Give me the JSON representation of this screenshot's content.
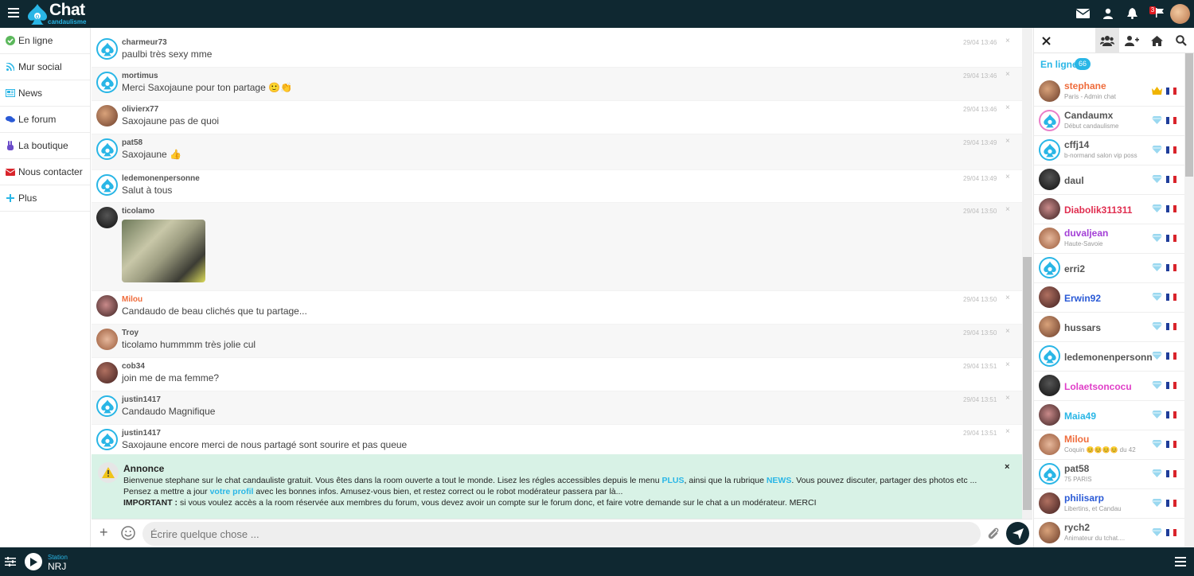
{
  "app": {
    "logo_main": "Chat",
    "logo_sub": "candaulisme",
    "notification_count": "3"
  },
  "colors": {
    "bar": "#0f2831",
    "accent": "#29b6e6",
    "annonce_bg": "#d8f2e6"
  },
  "nav": [
    {
      "label": "En ligne",
      "icon": "check-circle-icon",
      "color": "#5cb85c"
    },
    {
      "label": "Mur social",
      "icon": "rss-icon",
      "color": "#29b6e6"
    },
    {
      "label": "News",
      "icon": "newspaper-icon",
      "color": "#29b6e6"
    },
    {
      "label": "Le forum",
      "icon": "comments-icon",
      "color": "#2a5ad6"
    },
    {
      "label": "La boutique",
      "icon": "peace-hand-icon",
      "color": "#6b4cc9"
    },
    {
      "label": "Nous contacter",
      "icon": "envelope-icon",
      "color": "#d9242b"
    },
    {
      "label": "Plus",
      "icon": "plus-icon",
      "color": "#29b6e6"
    }
  ],
  "messages": [
    {
      "user": "charmeur73",
      "text": "paulbi très sexy mme",
      "time": "29/04 13:46",
      "avatar": "spade",
      "name_color": "#555"
    },
    {
      "user": "mortimus",
      "text": "Merci Saxojaune pour ton partage 🙂👏",
      "time": "29/04 13:46",
      "avatar": "spade",
      "name_color": "#555"
    },
    {
      "user": "olivierx77",
      "text": "Saxojaune pas de quoi",
      "time": "29/04 13:46",
      "avatar": "photo",
      "name_color": "#555"
    },
    {
      "user": "pat58",
      "text": "Saxojaune 👍",
      "time": "29/04 13:49",
      "avatar": "spade",
      "name_color": "#555"
    },
    {
      "user": "ledemonenpersonne",
      "text": "Salut à tous",
      "time": "29/04 13:49",
      "avatar": "spade",
      "name_color": "#555"
    },
    {
      "user": "ticolamo",
      "text": "",
      "time": "29/04 13:50",
      "avatar": "photo",
      "name_color": "#555",
      "image": true
    },
    {
      "user": "Milou",
      "text": "Candaudo de beau clichés que tu partage...",
      "time": "29/04 13:50",
      "avatar": "photo",
      "name_color": "#ef6c3c"
    },
    {
      "user": "Troy",
      "text": "ticolamo hummmm très jolie cul",
      "time": "29/04 13:50",
      "avatar": "photo",
      "name_color": "#555"
    },
    {
      "user": "cob34",
      "text": "join me de ma femme?",
      "time": "29/04 13:51",
      "avatar": "photo",
      "name_color": "#555"
    },
    {
      "user": "justin1417",
      "text": "Candaudo Magnifique",
      "time": "29/04 13:51",
      "avatar": "spade",
      "name_color": "#555"
    },
    {
      "user": "justin1417",
      "text": "Saxojaune encore merci de nous partagé sont sourire et pas queue",
      "time": "29/04 13:51",
      "avatar": "spade",
      "name_color": "#555"
    }
  ],
  "annonce": {
    "title": "Annonce",
    "p1": "Bienvenue stephane sur le chat candauliste gratuit. Vous êtes dans la room ouverte a tout le monde. Lisez les régles accessibles depuis le menu ",
    "plus": "PLUS",
    "p2": ", ainsi que la rubrique ",
    "news": "NEWS",
    "p3": ". Vous pouvez discuter, partager des photos etc ... Pensez a mettre a jour ",
    "profil": "votre profil",
    "p4": " avec les bonnes infos. Amusez-vous bien, et restez correct ou le robot modérateur passera par là...",
    "imp": "IMPORTANT :",
    "p5": " si vous voulez accès a la room réservée aux membres du forum, vous devez avoir un compte sur le forum donc, et faire votre demande sur le chat a un modérateur. MERCI",
    "close": "×"
  },
  "input": {
    "placeholder": "Écrire quelque chose ..."
  },
  "right_panel": {
    "online_label": "En ligne",
    "online_count": "66",
    "users": [
      {
        "name": "stephane",
        "sub": "Paris - Admin chat",
        "color": "#ef6c3c",
        "avatar": "photo",
        "badge": "crown"
      },
      {
        "name": "Candaumx",
        "sub": "Début candaulisme",
        "color": "#555",
        "avatar": "spade-pink",
        "badge": "diamond"
      },
      {
        "name": "cffj14",
        "sub": "b-normand salon vip poss",
        "color": "#555",
        "avatar": "spade",
        "badge": "diamond"
      },
      {
        "name": "daul",
        "sub": "",
        "color": "#555",
        "avatar": "photo",
        "badge": "diamond"
      },
      {
        "name": "Diabolik311311",
        "sub": "",
        "color": "#e02d4f",
        "avatar": "photo",
        "badge": "diamond"
      },
      {
        "name": "duvaljean",
        "sub": "Haute-Savoie",
        "color": "#a33fd6",
        "avatar": "photo",
        "badge": "diamond"
      },
      {
        "name": "erri2",
        "sub": "",
        "color": "#555",
        "avatar": "spade",
        "badge": "diamond"
      },
      {
        "name": "Erwin92",
        "sub": "",
        "color": "#2a5ad6",
        "avatar": "photo",
        "badge": "diamond"
      },
      {
        "name": "hussars",
        "sub": "",
        "color": "#555",
        "avatar": "photo",
        "badge": "diamond"
      },
      {
        "name": "ledemonenpersonn",
        "sub": "",
        "color": "#555",
        "avatar": "spade",
        "badge": "diamond"
      },
      {
        "name": "Lolaetsoncocu",
        "sub": "",
        "color": "#e040c8",
        "avatar": "photo",
        "badge": "diamond"
      },
      {
        "name": "Maia49",
        "sub": "",
        "color": "#29b6e6",
        "avatar": "photo",
        "badge": "diamond"
      },
      {
        "name": "Milou",
        "sub": "Coquin 😊😊😊😊 du 42",
        "color": "#ef6c3c",
        "avatar": "photo",
        "badge": "diamond"
      },
      {
        "name": "pat58",
        "sub": "75 PARIS",
        "color": "#555",
        "avatar": "spade",
        "badge": "diamond"
      },
      {
        "name": "philisarp",
        "sub": "Libertins, et Candau",
        "color": "#2a5ad6",
        "avatar": "photo",
        "badge": "diamond"
      },
      {
        "name": "rych2",
        "sub": "Animateur du tchat....",
        "color": "#555",
        "avatar": "photo",
        "badge": "diamond"
      }
    ]
  },
  "bottom": {
    "station_label": "Station",
    "station_name": "NRJ"
  }
}
